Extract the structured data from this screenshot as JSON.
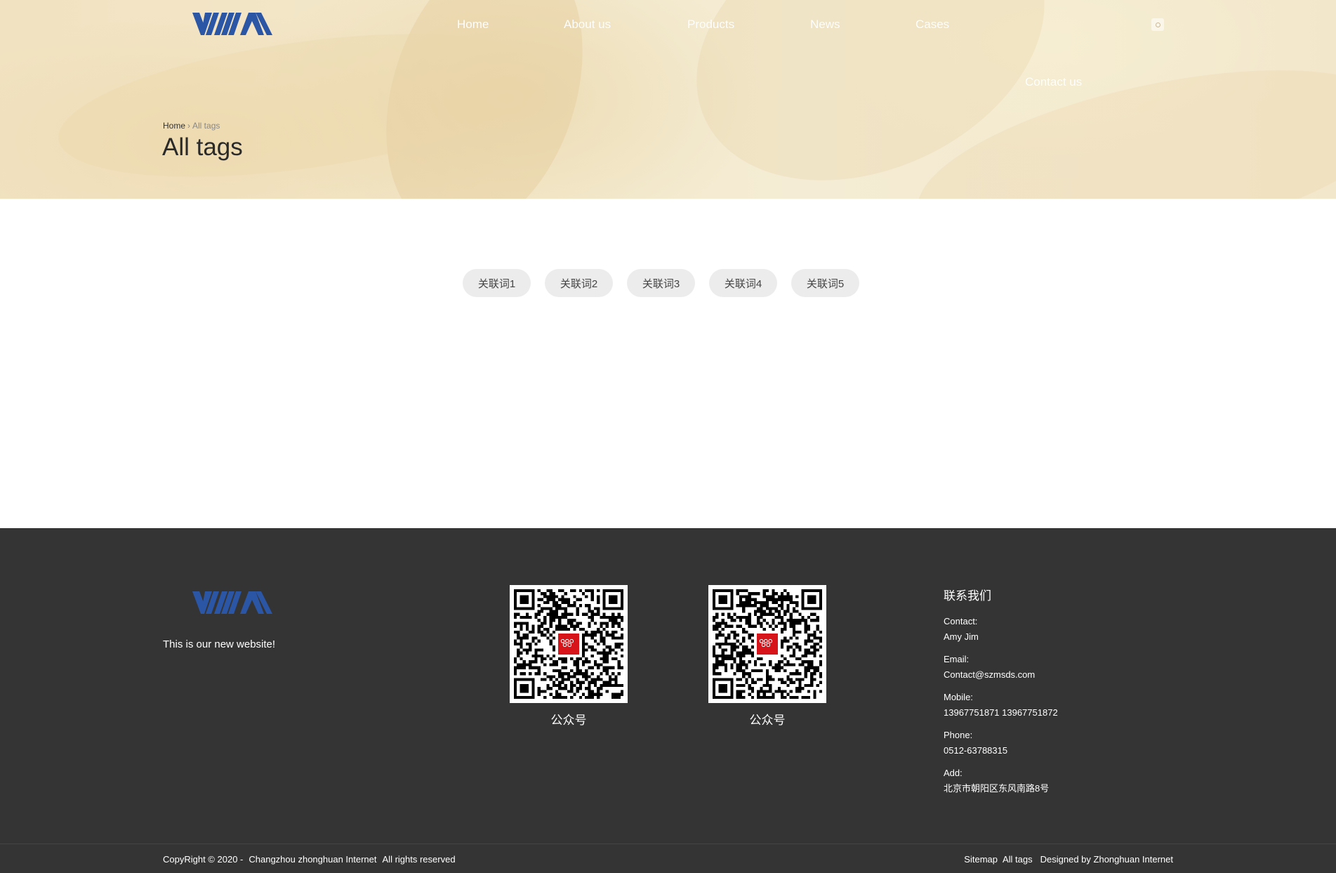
{
  "brand": {
    "logo_text": "YUIA",
    "logo_color": "#2b56a5"
  },
  "nav": {
    "items": [
      "Home",
      "About us",
      "Products",
      "News",
      "Cases",
      "Contact us"
    ]
  },
  "breadcrumb": {
    "home": "Home",
    "separator": "›",
    "current": "All tags"
  },
  "page": {
    "title": "All tags"
  },
  "tags": [
    "关联词1",
    "关联词2",
    "关联词3",
    "关联词4",
    "关联词5"
  ],
  "footer": {
    "tagline": "This is our new website!",
    "qr_codes": [
      {
        "caption": "公众号"
      },
      {
        "caption": "公众号"
      }
    ],
    "contact": {
      "title": "联系我们",
      "contact_label": "Contact:",
      "contact_value": "Amy  Jim",
      "email_label": "Email:",
      "email_value": "Contact@szmsds.com",
      "mobile_label": "Mobile:",
      "mobile_value": "13967751871  13967751872",
      "phone_label": "Phone:",
      "phone_value": "0512-63788315",
      "add_label": "Add:",
      "add_value": "北京市朝阳区东风南路8号"
    },
    "copyright": {
      "prefix": "CopyRight © 2020 -",
      "company": "Changzhou zhonghuan Internet",
      "rights": "All rights reserved"
    },
    "links": {
      "sitemap": "Sitemap",
      "all_tags": "All tags",
      "designed": "Designed by Zhonghuan Internet"
    }
  },
  "colors": {
    "footer_bg": "#343434",
    "tag_bg": "#ececec",
    "qr_center": "#d7141a"
  }
}
